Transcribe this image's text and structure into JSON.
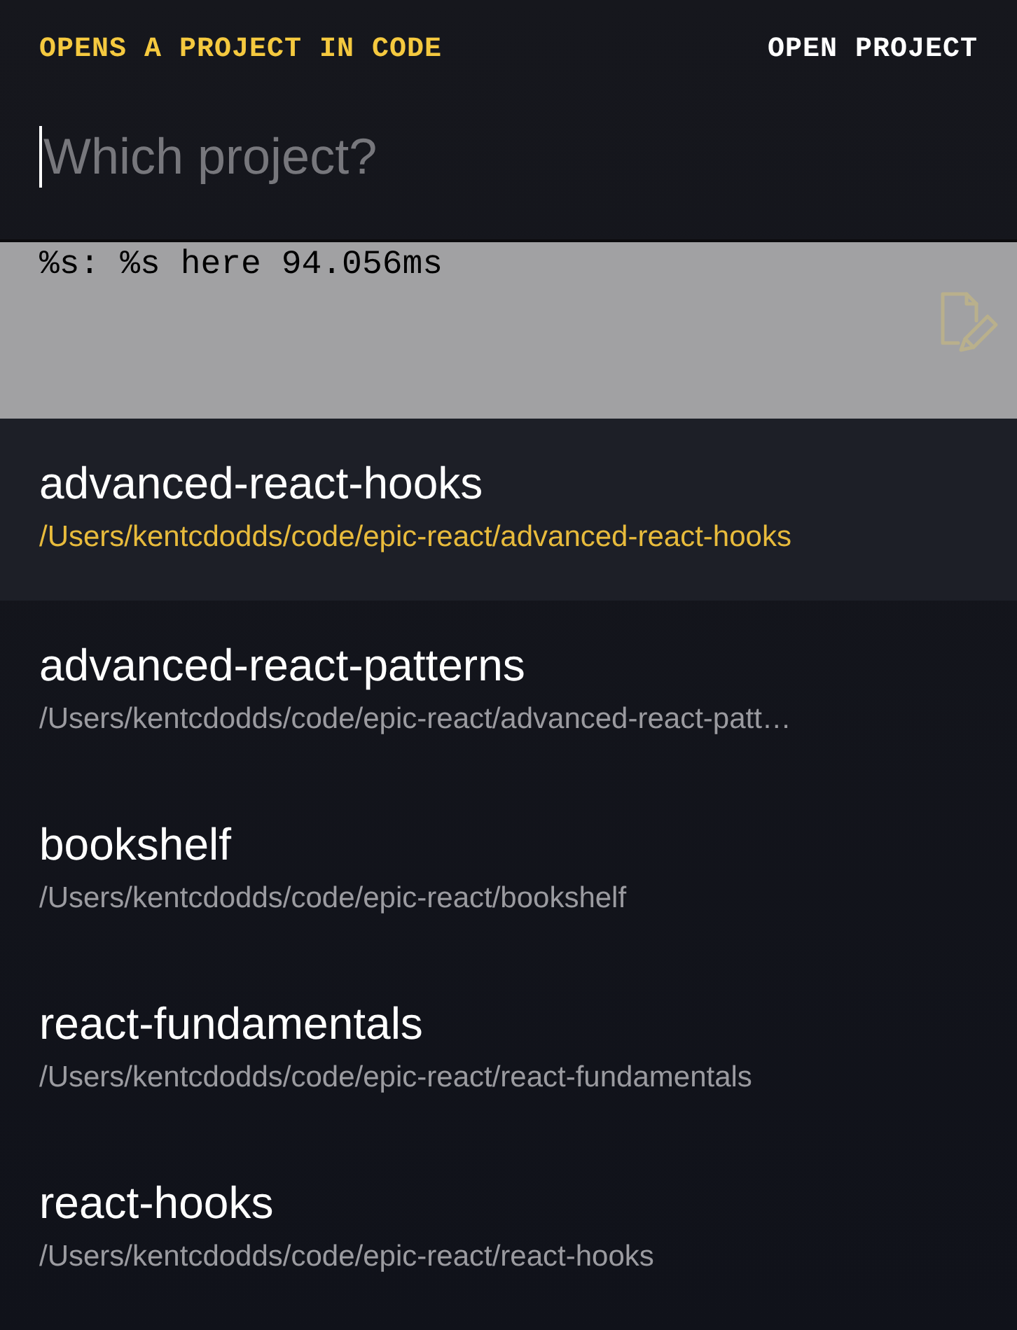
{
  "header": {
    "description": "OPENS A PROJECT IN CODE",
    "title": "OPEN PROJECT"
  },
  "input": {
    "placeholder": "Which project?"
  },
  "preview": {
    "text": "%s: %s here 94.056ms"
  },
  "projects": [
    {
      "name": "advanced-react-hooks",
      "path": "/Users/kentcdodds/code/epic-react/advanced-react-hooks",
      "selected": true
    },
    {
      "name": "advanced-react-patterns",
      "path": "/Users/kentcdodds/code/epic-react/advanced-react-patt…",
      "selected": false
    },
    {
      "name": "bookshelf",
      "path": "/Users/kentcdodds/code/epic-react/bookshelf",
      "selected": false
    },
    {
      "name": "react-fundamentals",
      "path": "/Users/kentcdodds/code/epic-react/react-fundamentals",
      "selected": false
    },
    {
      "name": "react-hooks",
      "path": "/Users/kentcdodds/code/epic-react/react-hooks",
      "selected": false
    }
  ]
}
